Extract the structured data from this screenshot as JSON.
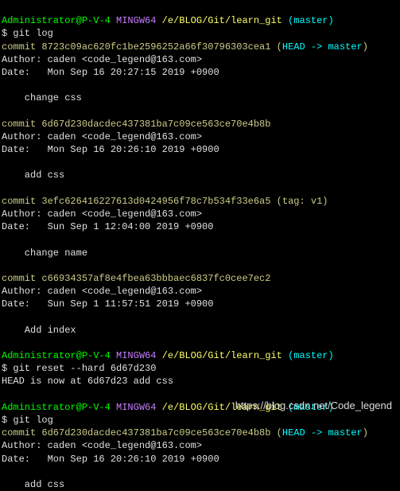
{
  "prompt": {
    "user": "Administrator@P-V-4",
    "shell": "MINGW64",
    "path": "/e/BLOG/Git/learn_git",
    "branch": "(master)",
    "symbol": "$"
  },
  "commands": {
    "cmd1": "git log",
    "cmd2": "git reset --hard 6d67d230",
    "cmd3": "git log"
  },
  "refs": {
    "head_master": "HEAD -> master",
    "tag_v1": "tag: v1"
  },
  "output": {
    "reset_result": "HEAD is now at 6d67d23 add css"
  },
  "commits": {
    "c1": {
      "line": "commit 8723c09ac620fc1be2596252a66f30796303cea1",
      "author": "Author: caden <code_legend@163.com>",
      "date": "Date:   Mon Sep 16 20:27:15 2019 +0900",
      "msg": "    change css"
    },
    "c2": {
      "line": "commit 6d67d230dacdec437381ba7c09ce563ce70e4b8b",
      "author": "Author: caden <code_legend@163.com>",
      "date": "Date:   Mon Sep 16 20:26:10 2019 +0900",
      "msg": "    add css"
    },
    "c3": {
      "line": "commit 3efc626416227613d0424956f78c7b534f33e6a5",
      "author": "Author: caden <code_legend@163.com>",
      "date": "Date:   Sun Sep 1 12:04:00 2019 +0900",
      "msg": "    change name"
    },
    "c4": {
      "line": "commit c66934357af8e4fbea63bbbaec6837fc0cee7ec2",
      "author": "Author: caden <code_legend@163.com>",
      "date": "Date:   Sun Sep 1 11:57:51 2019 +0900",
      "msg": "    Add index"
    },
    "c5": {
      "line": "commit 6d67d230dacdec437381ba7c09ce563ce70e4b8b",
      "author": "Author: caden <code_legend@163.com>",
      "date": "Date:   Mon Sep 16 20:26:10 2019 +0900",
      "msg": "    add css"
    }
  },
  "watermark": "https://blog.csdn.net/Code_legend"
}
